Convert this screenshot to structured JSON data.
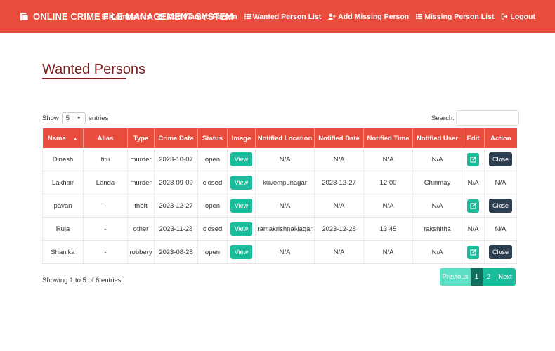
{
  "navbar": {
    "brand": "ONLINE CRIME FILE MANAGEMENT SYSTEM",
    "links": [
      {
        "label": "Complaints",
        "icon": "list-icon"
      },
      {
        "label": "Add Wanted Person",
        "icon": "user-plus-icon"
      },
      {
        "label": "Wanted Person List",
        "icon": "list-icon",
        "active": true
      },
      {
        "label": "Add Missing Person",
        "icon": "user-plus-icon"
      },
      {
        "label": "Missing Person List",
        "icon": "list-icon"
      },
      {
        "label": "Logout",
        "icon": "logout-icon"
      }
    ],
    "color": "#e74c3c"
  },
  "page": {
    "title": "Wanted Persons"
  },
  "controls": {
    "show_label": "Show",
    "entries_value": "5",
    "entries_label": "entries",
    "search_label": "Search:",
    "search_value": ""
  },
  "table": {
    "headers": [
      "Name",
      "Alias",
      "Type",
      "Crime Date",
      "Status",
      "Image",
      "Notified Location",
      "Notified Date",
      "Notified Time",
      "Notified User",
      "Edit",
      "Action"
    ],
    "view_label": "View",
    "close_label": "Close",
    "rows": [
      {
        "name": "Dinesh",
        "alias": "titu",
        "type": "murder",
        "crime_date": "2023-10-07",
        "status": "open",
        "notified_location": "N/A",
        "notified_date": "N/A",
        "notified_time": "N/A",
        "notified_user": "N/A",
        "edit": "",
        "action": ""
      },
      {
        "name": "Lakhbir",
        "alias": "Landa",
        "type": "murder",
        "crime_date": "2023-09-09",
        "status": "closed",
        "notified_location": "kuvempunagar",
        "notified_date": "2023-12-27",
        "notified_time": "12:00",
        "notified_user": "Chinmay",
        "edit": "N/A",
        "action": "N/A"
      },
      {
        "name": "pavan",
        "alias": "-",
        "type": "theft",
        "crime_date": "2023-12-27",
        "status": "open",
        "notified_location": "N/A",
        "notified_date": "N/A",
        "notified_time": "N/A",
        "notified_user": "N/A",
        "edit": "",
        "action": ""
      },
      {
        "name": "Ruja",
        "alias": "-",
        "type": "other",
        "crime_date": "2023-11-28",
        "status": "closed",
        "notified_location": "ramakrishnaNagar",
        "notified_date": "2023-12-28",
        "notified_time": "13:45",
        "notified_user": "rakshitha",
        "edit": "N/A",
        "action": "N/A"
      },
      {
        "name": "Shanika",
        "alias": "-",
        "type": "robbery",
        "crime_date": "2023-08-28",
        "status": "open",
        "notified_location": "N/A",
        "notified_date": "N/A",
        "notified_time": "N/A",
        "notified_user": "N/A",
        "edit": "",
        "action": ""
      }
    ]
  },
  "footer": {
    "info": "Showing 1 to 5 of 6 entries",
    "pagination": {
      "previous": "Previous",
      "pages": [
        "1",
        "2"
      ],
      "next": "Next",
      "current": "1"
    }
  }
}
